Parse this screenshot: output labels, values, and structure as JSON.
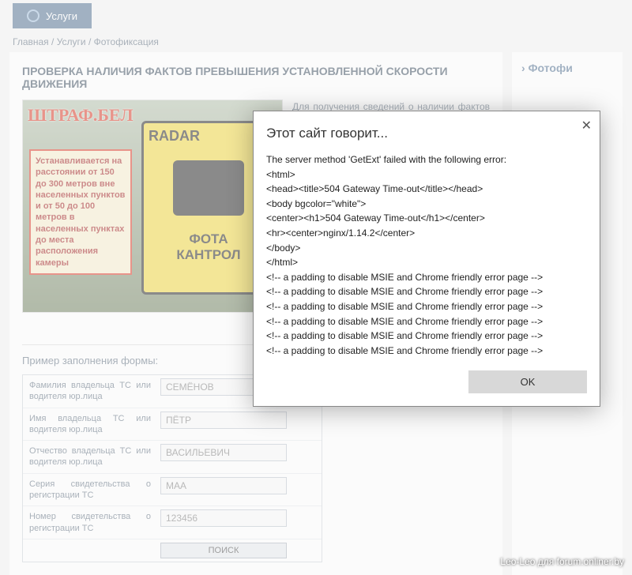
{
  "tab": {
    "label": "Услуги"
  },
  "breadcrumb": {
    "a": "Главная",
    "b": "Услуги",
    "c": "Фотофиксация"
  },
  "page": {
    "title": "ПРОВЕРКА НАЛИЧИЯ ФАКТОВ ПРЕВЫШЕНИЯ УСТАНОВЛЕННОЙ СКОРОСТИ ДВИЖЕНИЯ",
    "desc": "Для получения сведений о наличии фактов превышения установленной скорости движения, зафиксированных"
  },
  "hero": {
    "brand": "ШТРАФ.БЕЛ",
    "note": "Устанавливается на расстоянии от 150 до 300 метров вне населенных пунктов и от 50 до 100 метров в населенных пунктах до места расположения камеры",
    "sign_radar": "RADAR",
    "sign_txt1": "ФОТА",
    "sign_txt2": "КАНТРОЛ"
  },
  "sidebar": {
    "link": "Фотофи"
  },
  "form": {
    "title": "Пример заполнения формы:",
    "rows": [
      {
        "label": "Фамилия владельца ТС или водителя юр.лица",
        "value": "СЕМЁНОВ"
      },
      {
        "label": "Имя владельца ТС или водителя юр.лица",
        "value": "ПЁТР"
      },
      {
        "label": "Отчество владельца ТС или водителя юр.лица",
        "value": "ВАСИЛЬЕВИЧ"
      },
      {
        "label": "Серия свидетельства о регистрации ТС",
        "value": "МАА"
      },
      {
        "label": "Номер свидетельства о регистрации ТС",
        "value": "123456"
      }
    ],
    "submit": "ПОИСК"
  },
  "dialog": {
    "title": "Этот сайт говорит...",
    "body": "The server method 'GetExt' failed with the following error:\n<html>\n<head><title>504 Gateway Time-out</title></head>\n<body bgcolor=\"white\">\n<center><h1>504 Gateway Time-out</h1></center>\n<hr><center>nginx/1.14.2</center>\n</body>\n</html>\n<!-- a padding to disable MSIE and Chrome friendly error page -->\n<!-- a padding to disable MSIE and Chrome friendly error page -->\n<!-- a padding to disable MSIE and Chrome friendly error page -->\n<!-- a padding to disable MSIE and Chrome friendly error page -->\n<!-- a padding to disable MSIE and Chrome friendly error page -->\n<!-- a padding to disable MSIE and Chrome friendly error page -->",
    "ok": "OK"
  },
  "watermark": "Leo-Leo для forum.onliner.by"
}
